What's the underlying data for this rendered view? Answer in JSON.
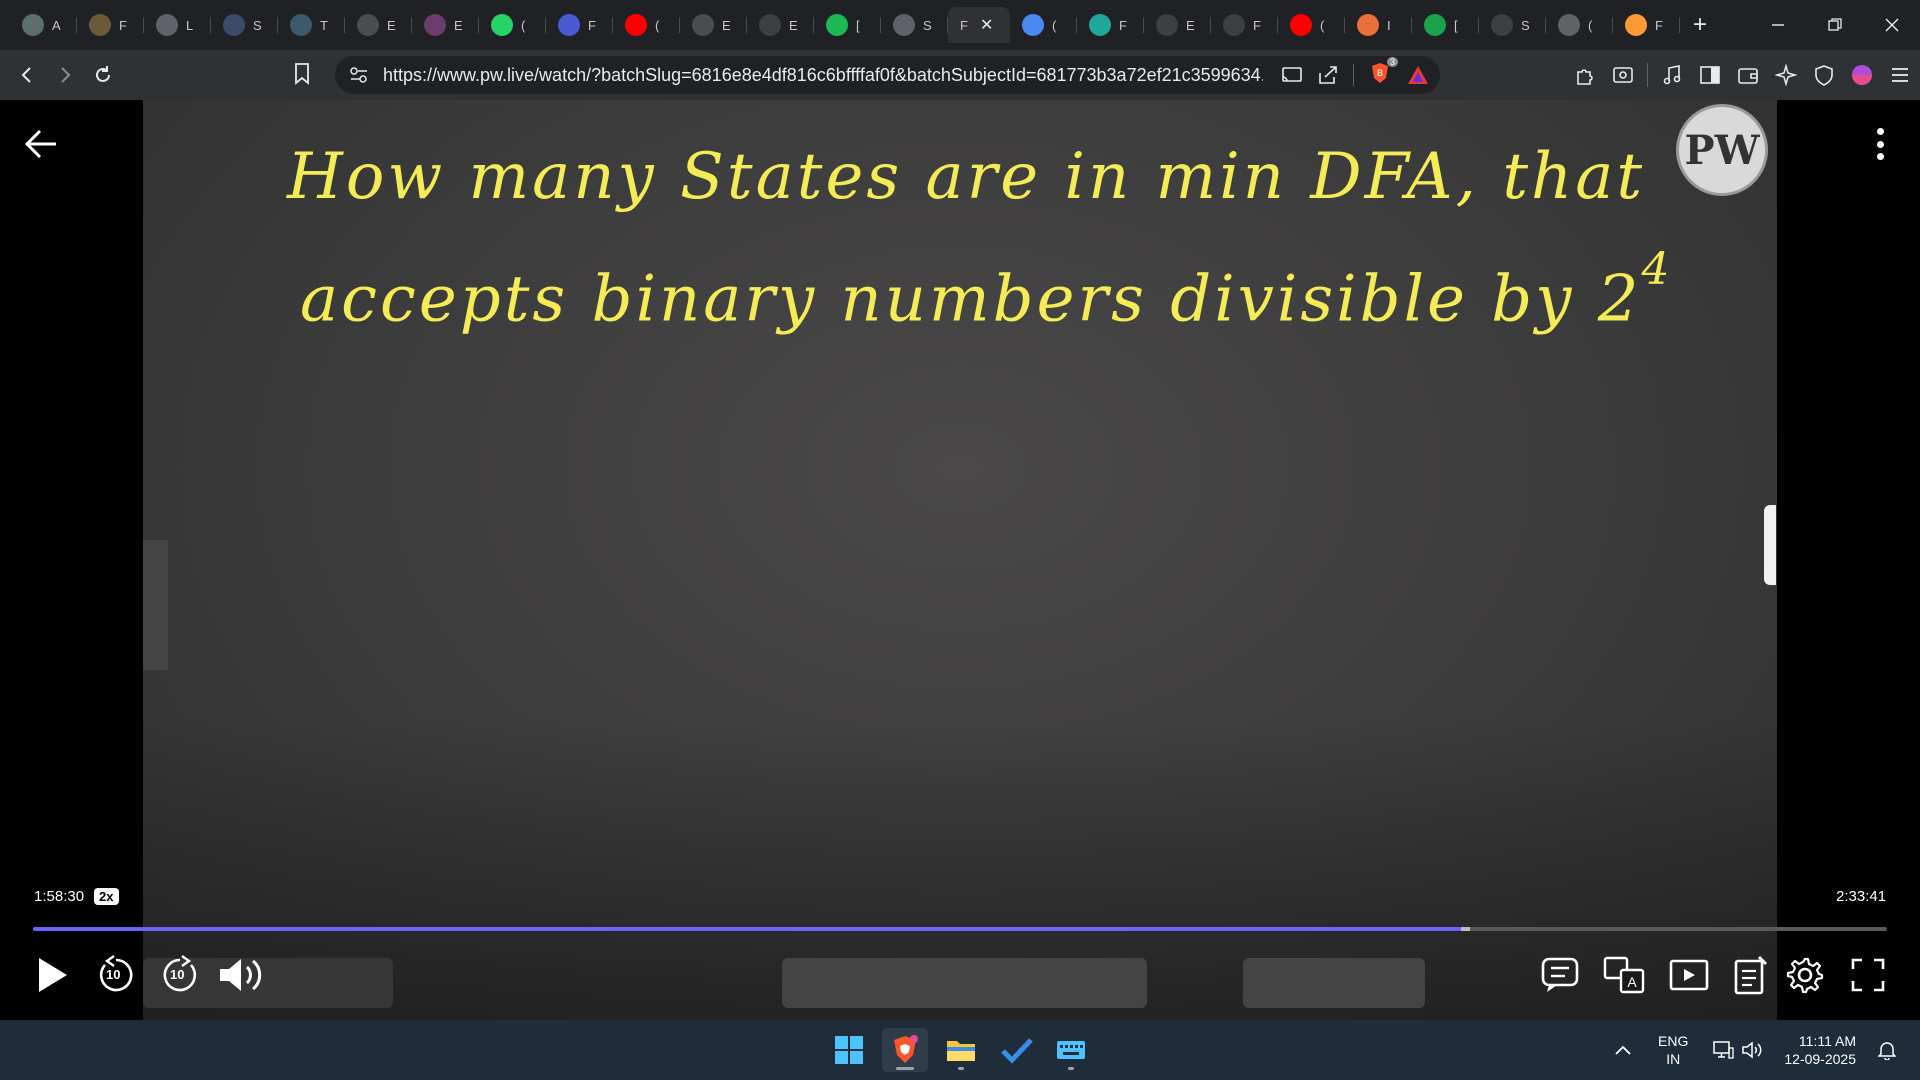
{
  "browser": {
    "tabs": [
      {
        "icon": "chatgpt-icon",
        "letter": "A",
        "color": "#5c6f6a"
      },
      {
        "icon": "bitcoin-icon",
        "letter": "F",
        "color": "#6a5a3a"
      },
      {
        "icon": "globe-icon",
        "letter": "L",
        "color": "#5f6368"
      },
      {
        "icon": "site-icon",
        "letter": "S",
        "color": "#3d4a6a"
      },
      {
        "icon": "w3schools-icon",
        "letter": "T",
        "color": "#3d5a6a"
      },
      {
        "icon": "site-icon",
        "letter": "E",
        "color": "#4a4c50"
      },
      {
        "icon": "site-icon",
        "letter": "E",
        "color": "#6a3d6a"
      },
      {
        "icon": "whatsapp-icon",
        "letter": "(",
        "color": "#25d366"
      },
      {
        "icon": "site-icon",
        "letter": "F",
        "color": "#4a5ad0"
      },
      {
        "icon": "youtube-icon",
        "letter": "(",
        "color": "#ff0000"
      },
      {
        "icon": "site-icon",
        "letter": "E",
        "color": "#4a4c50"
      },
      {
        "icon": "google-icon",
        "letter": "E",
        "color": "#ffffff"
      },
      {
        "icon": "spotify-icon",
        "letter": "[",
        "color": "#1db954"
      },
      {
        "icon": "globe-icon",
        "letter": "S",
        "color": "#5f6368"
      },
      {
        "icon": "site-icon",
        "letter": "F",
        "color": "#303134",
        "active": true
      },
      {
        "icon": "gemini-icon",
        "letter": "(",
        "color": "#4a8af0"
      },
      {
        "icon": "site-icon",
        "letter": "F",
        "color": "#1ea89a"
      },
      {
        "icon": "google-icon",
        "letter": "E",
        "color": "#ffffff"
      },
      {
        "icon": "monitor-icon",
        "letter": "F",
        "color": "#3c4043"
      },
      {
        "icon": "youtube-icon",
        "letter": "(",
        "color": "#ff0000"
      },
      {
        "icon": "site-icon",
        "letter": "I",
        "color": "#e8703a"
      },
      {
        "icon": "site-icon",
        "letter": "[",
        "color": "#1aa34a"
      },
      {
        "icon": "wikipedia-icon",
        "letter": "S",
        "color": "#ffffff"
      },
      {
        "icon": "globe-icon",
        "letter": "(",
        "color": "#5f6368"
      },
      {
        "icon": "india-flag-icon",
        "letter": "F",
        "color": "#ff9933"
      }
    ],
    "active_tab_letter": "F",
    "url": "https://www.pw.live/watch/?batchSlug=6816e8e4df816c6bffffaf0f&batchSubjectId=681773b3a72ef21c3599634...",
    "brave_badge": "3"
  },
  "video": {
    "handwriting_line1": "How many States are in min DFA, that",
    "handwriting_line2": "accepts binary numbers divisible by 2",
    "handwriting_exponent": "4",
    "logo_text": "PW",
    "current_time": "1:58:30",
    "speed": "2x",
    "total_time": "2:33:41",
    "progress": 0.77,
    "buffered": 0.775,
    "skip_back_label": "10",
    "skip_forward_label": "10"
  },
  "taskbar": {
    "lang_line1": "ENG",
    "lang_line2": "IN",
    "time": "11:11 AM",
    "date": "12-09-2025"
  }
}
